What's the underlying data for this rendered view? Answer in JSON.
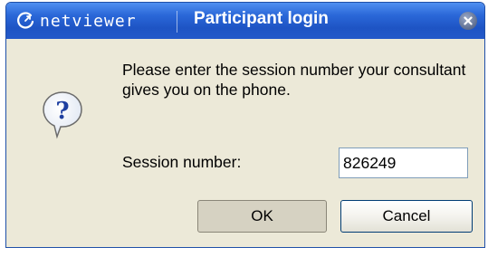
{
  "titlebar": {
    "brand": "netviewer",
    "title": "Participant login",
    "brand_icon": "netviewer-logo-icon",
    "close_icon": "close-icon"
  },
  "body": {
    "icon": "question-icon",
    "message": "Please enter the session number your consultant gives you on the phone.",
    "session_label": "Session number:",
    "session_value": "826249"
  },
  "buttons": {
    "ok": "OK",
    "cancel": "Cancel"
  },
  "colors": {
    "titlebar": "#2a67d8",
    "dialog_bg": "#ece9d8"
  }
}
